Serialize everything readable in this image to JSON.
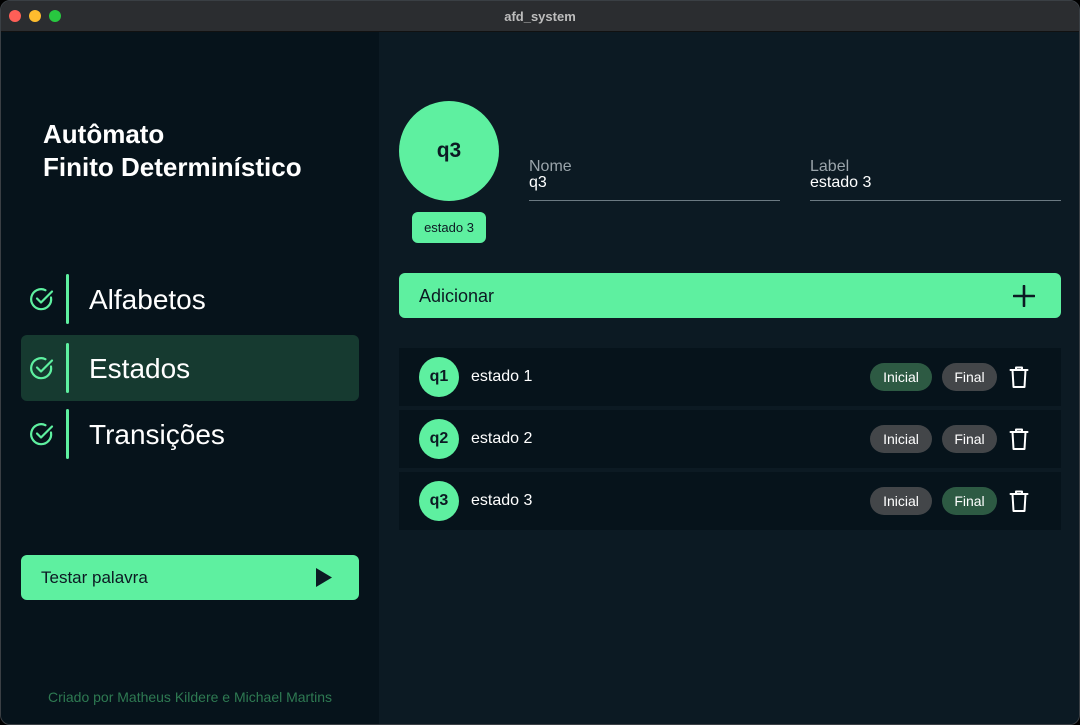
{
  "window": {
    "title": "afd_system"
  },
  "sidebar": {
    "title_line1": "Autômato",
    "title_line2": "Finito Determinístico",
    "items": [
      {
        "label": "Alfabetos",
        "active": false,
        "icon": "check-circle-icon"
      },
      {
        "label": "Estados",
        "active": true,
        "icon": "check-circle-icon"
      },
      {
        "label": "Transições",
        "active": false,
        "icon": "check-circle-icon"
      }
    ],
    "test_button_label": "Testar palavra",
    "test_button_icon": "play-icon",
    "credit": "Criado por Matheus Kildere e Michael Martins"
  },
  "main": {
    "selected_state": {
      "name": "q3",
      "label": "estado 3"
    },
    "fields": {
      "nome_label": "Nome",
      "nome_value": "q3",
      "label_label": "Label",
      "label_value": "estado 3"
    },
    "add_button": {
      "label": "Adicionar",
      "icon": "plus-icon"
    },
    "states": [
      {
        "name": "q1",
        "label": "estado 1",
        "inicial_label": "Inicial",
        "final_label": "Final",
        "inicial": true,
        "final": false
      },
      {
        "name": "q2",
        "label": "estado 2",
        "inicial_label": "Inicial",
        "final_label": "Final",
        "inicial": false,
        "final": false
      },
      {
        "name": "q3",
        "label": "estado 3",
        "inicial_label": "Inicial",
        "final_label": "Final",
        "inicial": false,
        "final": true
      }
    ]
  },
  "colors": {
    "accent": "#5ef0a0",
    "sidebar_bg": "#06131b",
    "main_bg": "#0c1a23",
    "active_nav_bg": "#163a30",
    "pill_on": "#2d5a43",
    "pill_off": "#434649",
    "credit": "#2e7a52"
  }
}
